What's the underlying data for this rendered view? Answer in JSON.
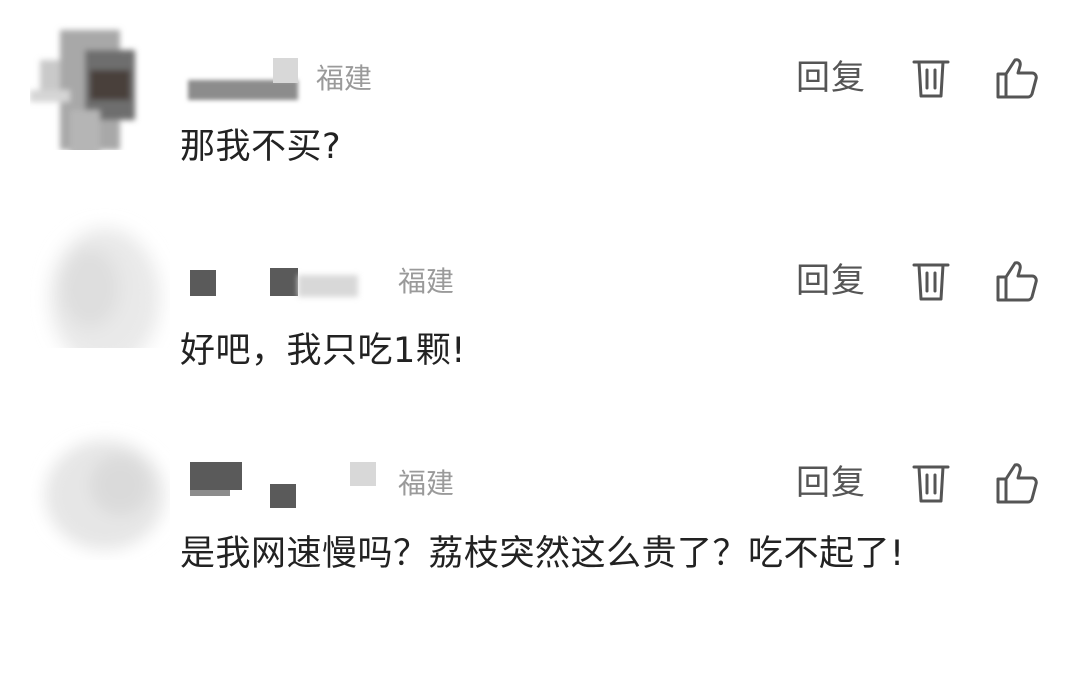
{
  "comments": [
    {
      "region": "福建",
      "reply_label": "回复",
      "text": "那我不买?"
    },
    {
      "region": "福建",
      "reply_label": "回复",
      "text": "好吧，我只吃1颗!"
    },
    {
      "region": "福建",
      "reply_label": "回复",
      "text": "是我网速慢吗？荔枝突然这么贵了？吃不起了!"
    }
  ],
  "icons": {
    "delete": "trash-icon",
    "like": "thumbs-up-icon"
  },
  "colors": {
    "text": "#222222",
    "meta": "#9a9a9a",
    "action": "#555555",
    "background": "#ffffff"
  }
}
